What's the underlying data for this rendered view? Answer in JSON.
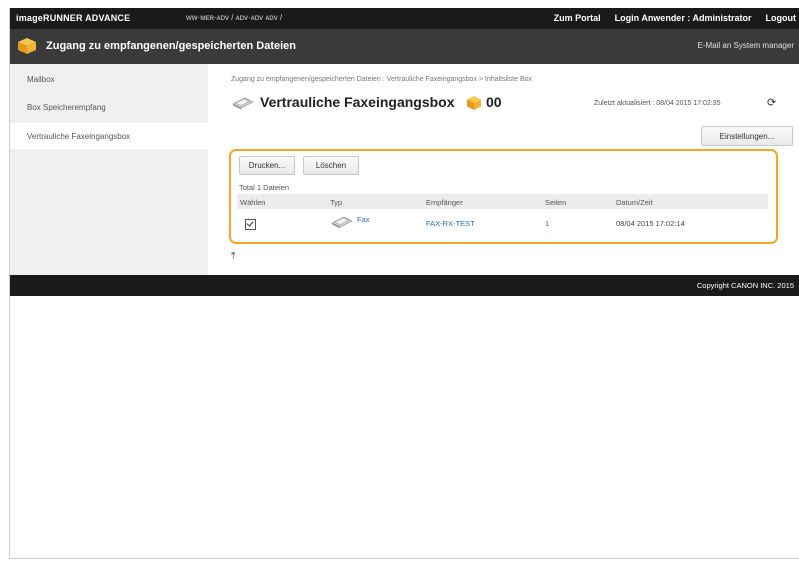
{
  "topbar": {
    "brand": "imageRUNNER ADVANCE",
    "host": "ᴡᴡ·ᴍᴇʀ-ᴀᴅᴠ / ᴀᴅᴠ·ᴀᴅᴠ ᴀᴅᴠ /",
    "portal": "Zum Portal",
    "login": "Login Anwender : Administrator",
    "logout": "Logout"
  },
  "titlebar": {
    "title": "Zugang zu empfangenen/gespeicherten Dateien",
    "mail": "E-Mail an System manager"
  },
  "sidebar": {
    "items": [
      {
        "label": "Mailbox"
      },
      {
        "label": "Box Speicherempfang"
      },
      {
        "label": "Vertrauliche Faxeingangsbox"
      }
    ]
  },
  "main": {
    "breadcrumb": "Zugang zu empfangenen/gespeicherten Dateien : Vertrauliche Faxeingangsbox > Inhaltsliste Box",
    "title": "Vertrauliche Faxeingangsbox",
    "box_number": "00",
    "updated": "Zuletzt aktualisiert : 08/04 2015 17:02:35",
    "settings_label": "Einstellungen..."
  },
  "panel": {
    "print_label": "Drucken...",
    "delete_label": "Löschen",
    "total": "Total 1 Dateien",
    "columns": [
      "Wählen",
      "Typ",
      "Empfänger",
      "Seiten",
      "Datum/Zeit"
    ],
    "rows": [
      {
        "selected": true,
        "type": "Fax",
        "recipient": "FAX-RX-TEST",
        "pages": "1",
        "datetime": "08/04 2015 17:02:14"
      }
    ]
  },
  "footer": {
    "copyright": "Copyright CANON INC. 2015"
  },
  "colors": {
    "highlight": "#f5a623",
    "link": "#2f6fb3",
    "topbar": "#1a1a1a",
    "titlebar": "#3a3a3a"
  }
}
